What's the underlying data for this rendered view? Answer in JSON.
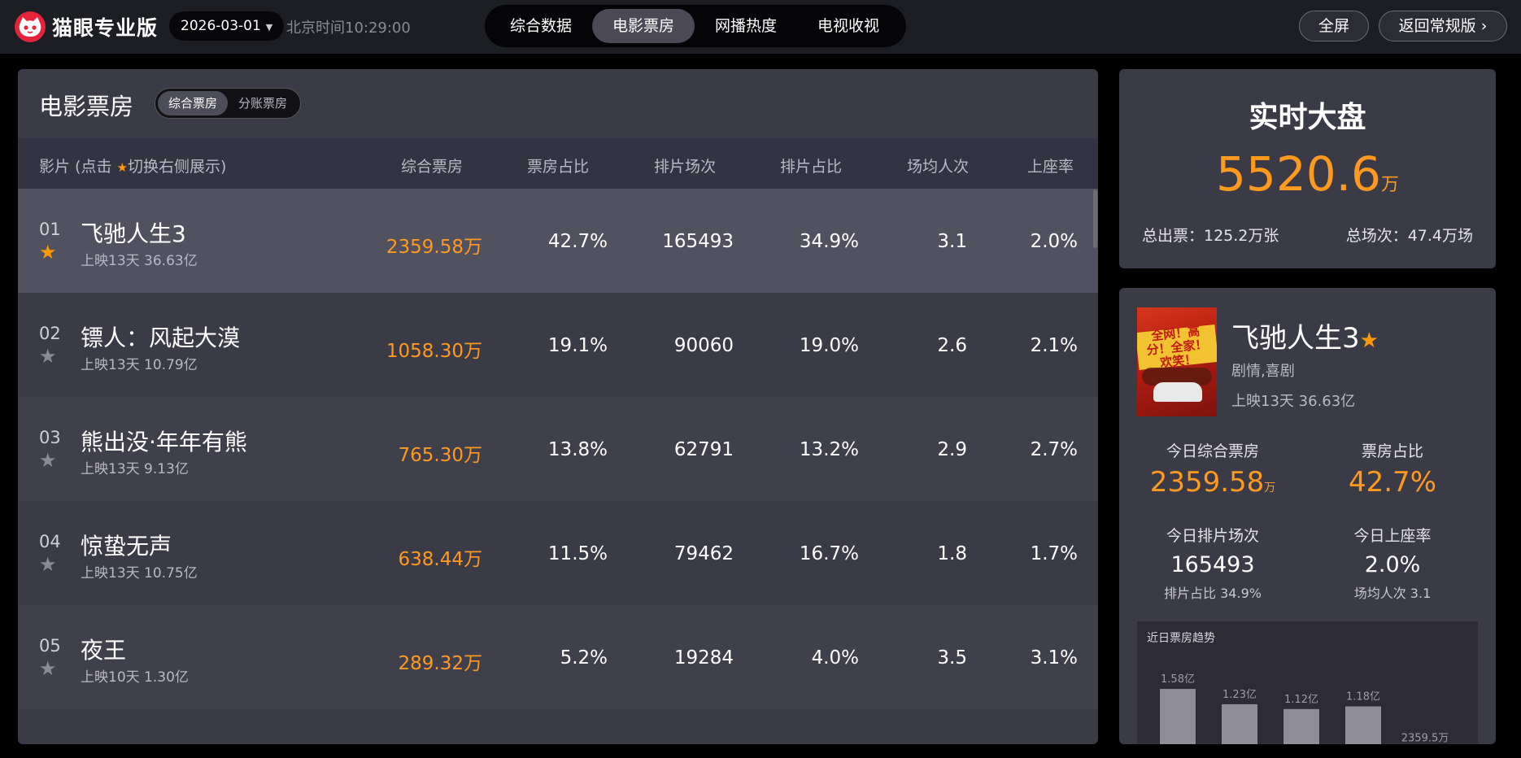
{
  "header": {
    "app_title": "猫眼专业版",
    "date": "2026-03-01",
    "clock": "北京时间10:29:00",
    "nav_tabs": [
      "综合数据",
      "电影票房",
      "网播热度",
      "电视收视"
    ],
    "active_tab": "电影票房",
    "fullscreen_label": "全屏",
    "back_label": "返回常规版 ›"
  },
  "box_office": {
    "title": "电影票房",
    "toggle": [
      "综合票房",
      "分账票房"
    ],
    "columns": {
      "film": "影片 (点击",
      "film_suffix": "切换右侧展示)",
      "gross": "综合票房",
      "gross_share": "票房占比",
      "shows": "排片场次",
      "show_share": "排片占比",
      "avg_people": "场均人次",
      "occupancy": "上座率"
    },
    "rows": [
      {
        "rank": "01",
        "name": "飞驰人生3",
        "release": "上映13天  36.63亿",
        "gross": "2359.58万",
        "gross_share": "42.7%",
        "shows": "165493",
        "show_share": "34.9%",
        "avg_people": "3.1",
        "occupancy": "2.0%"
      },
      {
        "rank": "02",
        "name": "镖人：风起大漠",
        "release": "上映13天  10.79亿",
        "gross": "1058.30万",
        "gross_share": "19.1%",
        "shows": "90060",
        "show_share": "19.0%",
        "avg_people": "2.6",
        "occupancy": "2.1%"
      },
      {
        "rank": "03",
        "name": "熊出没·年年有熊",
        "release": "上映13天  9.13亿",
        "gross": "765.30万",
        "gross_share": "13.8%",
        "shows": "62791",
        "show_share": "13.2%",
        "avg_people": "2.9",
        "occupancy": "2.7%"
      },
      {
        "rank": "04",
        "name": "惊蛰无声",
        "release": "上映13天  10.75亿",
        "gross": "638.44万",
        "gross_share": "11.5%",
        "shows": "79462",
        "show_share": "16.7%",
        "avg_people": "1.8",
        "occupancy": "1.7%"
      },
      {
        "rank": "05",
        "name": "夜王",
        "release": "上映10天  1.30亿",
        "gross": "289.32万",
        "gross_share": "5.2%",
        "shows": "19284",
        "show_share": "4.0%",
        "avg_people": "3.5",
        "occupancy": "3.1%"
      }
    ]
  },
  "realtime": {
    "title": "实时大盘",
    "value": "5520.6",
    "unit": "万",
    "total_tickets": "总出票：125.2万张",
    "total_shows": "总场次：47.4万场"
  },
  "detail": {
    "poster_text": "全网！高分！全家！欢笑！",
    "name": "飞驰人生3",
    "genre": "剧情,喜剧",
    "release": "上映13天  36.63亿",
    "today_gross_label": "今日综合票房",
    "today_gross": "2359.58",
    "today_gross_unit": "万",
    "gross_share_label": "票房占比",
    "gross_share": "42.7%",
    "today_shows_label": "今日排片场次",
    "today_shows": "165493",
    "show_share": "排片占比 34.9%",
    "occupancy_label": "今日上座率",
    "occupancy": "2.0%",
    "avg_people": "场均人次 3.1",
    "trend_title": "近日票房趋势"
  },
  "colors": {
    "accent": "#ff9a1f",
    "panel": "#3b3a47",
    "selected_row": "#52515f",
    "brand_red": "#e5233a"
  },
  "chart_data": {
    "type": "bar",
    "title": "近日票房趋势",
    "categories": [
      "",
      "",
      "",
      "",
      ""
    ],
    "values": [
      15800,
      12300,
      11200,
      11800,
      2359.5
    ],
    "labels": [
      "1.58亿",
      "1.23亿",
      "1.12亿",
      "1.18亿",
      "2359.5万"
    ],
    "unit": "万",
    "ylim": [
      0,
      16000
    ],
    "grid": false,
    "color": "#8e8d99"
  }
}
